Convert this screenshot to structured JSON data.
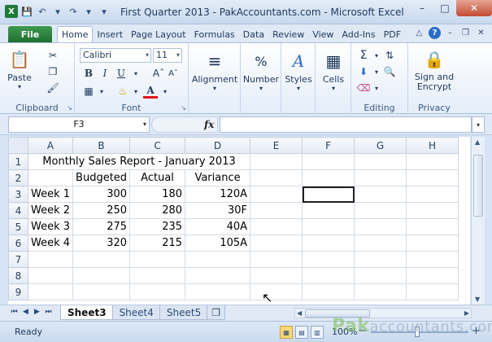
{
  "window": {
    "title": "First Quarter 2013 - PakAccountants.com  -  Microsoft Excel",
    "app_icon": "X"
  },
  "ribbon_tabs": {
    "file": "File",
    "tabs": [
      "Home",
      "Insert",
      "Page Layout",
      "Formulas",
      "Data",
      "Review",
      "View",
      "Add-Ins",
      "PDF"
    ],
    "active": "Home"
  },
  "ribbon": {
    "clipboard": {
      "label": "Clipboard",
      "paste": "Paste"
    },
    "font": {
      "label": "Font",
      "family": "Calibri",
      "size": "11",
      "bold": "B",
      "italic": "I",
      "underline": "U",
      "font_color_glyph": "A",
      "font_color": "#e3141e"
    },
    "alignment": {
      "label": "Alignment"
    },
    "number": {
      "label": "Number",
      "glyph": "%"
    },
    "styles": {
      "label": "Styles"
    },
    "cells": {
      "label": "Cells"
    },
    "editing": {
      "label": "Editing",
      "sum_glyph": "Σ"
    },
    "privacy": {
      "label": "Privacy",
      "button": "Sign and Encrypt"
    }
  },
  "formula_bar": {
    "name_box": "F3",
    "fx": "fx",
    "formula": ""
  },
  "sheet": {
    "columns": [
      "A",
      "B",
      "C",
      "D",
      "E",
      "F",
      "G",
      "H"
    ],
    "rows": [
      {
        "n": "1",
        "cells": [
          "Monthly Sales Report - January 2013",
          "",
          "",
          "",
          "",
          "",
          "",
          ""
        ]
      },
      {
        "n": "2",
        "cells": [
          "",
          "Budgeted",
          "Actual",
          "Variance",
          "",
          "",
          "",
          ""
        ]
      },
      {
        "n": "3",
        "cells": [
          "Week 1",
          "300",
          "180",
          "120A",
          "",
          "",
          "",
          ""
        ]
      },
      {
        "n": "4",
        "cells": [
          "Week 2",
          "250",
          "280",
          "30F",
          "",
          "",
          "",
          ""
        ]
      },
      {
        "n": "5",
        "cells": [
          "Week 3",
          "275",
          "235",
          "40A",
          "",
          "",
          "",
          ""
        ]
      },
      {
        "n": "6",
        "cells": [
          "Week 4",
          "320",
          "215",
          "105A",
          "",
          "",
          "",
          ""
        ]
      },
      {
        "n": "7",
        "cells": [
          "",
          "",
          "",
          "",
          "",
          "",
          "",
          ""
        ]
      },
      {
        "n": "8",
        "cells": [
          "",
          "",
          "",
          "",
          "",
          "",
          "",
          ""
        ]
      },
      {
        "n": "9",
        "cells": [
          "",
          "",
          "",
          "",
          "",
          "",
          "",
          ""
        ]
      }
    ]
  },
  "sheet_tabs": {
    "tabs": [
      "Sheet3",
      "Sheet4",
      "Sheet5"
    ],
    "active": "Sheet3"
  },
  "status_bar": {
    "status": "Ready",
    "zoom": "100%"
  },
  "watermark": {
    "brand": "Pak",
    "rest": "accountants.com"
  }
}
